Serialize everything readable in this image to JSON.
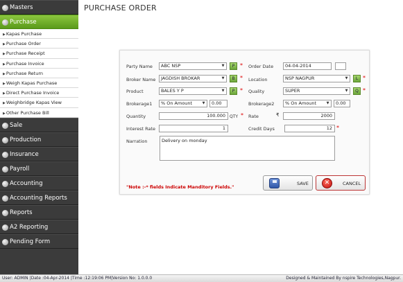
{
  "sidebar": {
    "masters": "Masters",
    "purchase": "Purchase",
    "purchase_items": [
      "Kapas Purchase",
      "Purchase Order",
      "Purchase Receipt",
      "Purchase Invoice",
      "Purchase Return",
      "Weigh Kapas Purchase",
      "Direct Purchase Invoice",
      "Weighbridge Kapas View",
      "Other Purchase Bill"
    ],
    "sections": [
      "Sale",
      "Production",
      "Insurance",
      "Payroll",
      "Accounting",
      "Accounting Reports",
      "Reports",
      "A2 Reporting",
      "Pending Form"
    ]
  },
  "page": {
    "title": "PURCHASE ORDER"
  },
  "form": {
    "party_name_label": "Party Name",
    "party_name_value": "ABC NSP",
    "party_btn": "P",
    "order_date_label": "Order Date",
    "order_date_value": "04-04-2014",
    "broker_name_label": "Broker Name",
    "broker_name_value": "JAGDISH BROKAR",
    "broker_btn": "B",
    "location_label": "Location",
    "location_value": "NSP NAGPUR",
    "location_btn": "L",
    "product_label": "Product",
    "product_value": "BALES Y P",
    "product_btn": "P",
    "quality_label": "Quality",
    "quality_value": "SUPER",
    "quality_btn": "Q",
    "brokerage1_label": "Brokerage1",
    "brokerage1_type": "% On Amount",
    "brokerage1_value": "0.00",
    "brokerage2_label": "Brokerage2",
    "brokerage2_type": "% On Amount",
    "brokerage2_value": "0.00",
    "quantity_label": "Quantity",
    "quantity_value": "100.000",
    "quantity_unit": "QTY",
    "rate_label": "Rate",
    "rate_symbol": "₹",
    "rate_value": "2000",
    "interest_rate_label": "Interest Rate",
    "interest_rate_value": "1",
    "credit_days_label": "Credit Days",
    "credit_days_value": "12",
    "narration_label": "Narration",
    "narration_value": "Delivery on monday",
    "required_mark": "*"
  },
  "note": "\"Note :-* fields Indicate Manditory Fields.\"",
  "buttons": {
    "save": "SAVE",
    "cancel": "CANCEL"
  },
  "statusbar": {
    "left": "User: ADMIN |Date :04-Apr-2014 |Time :12:19:06 PM|Version No: 1.0.0.0",
    "right": "Designed & Maintained By nspire Technologies,Nagpur."
  },
  "colors": {
    "sidebar_bg": "#3b3b3b",
    "active_green": "#6fb02a",
    "required": "#dd0000"
  }
}
